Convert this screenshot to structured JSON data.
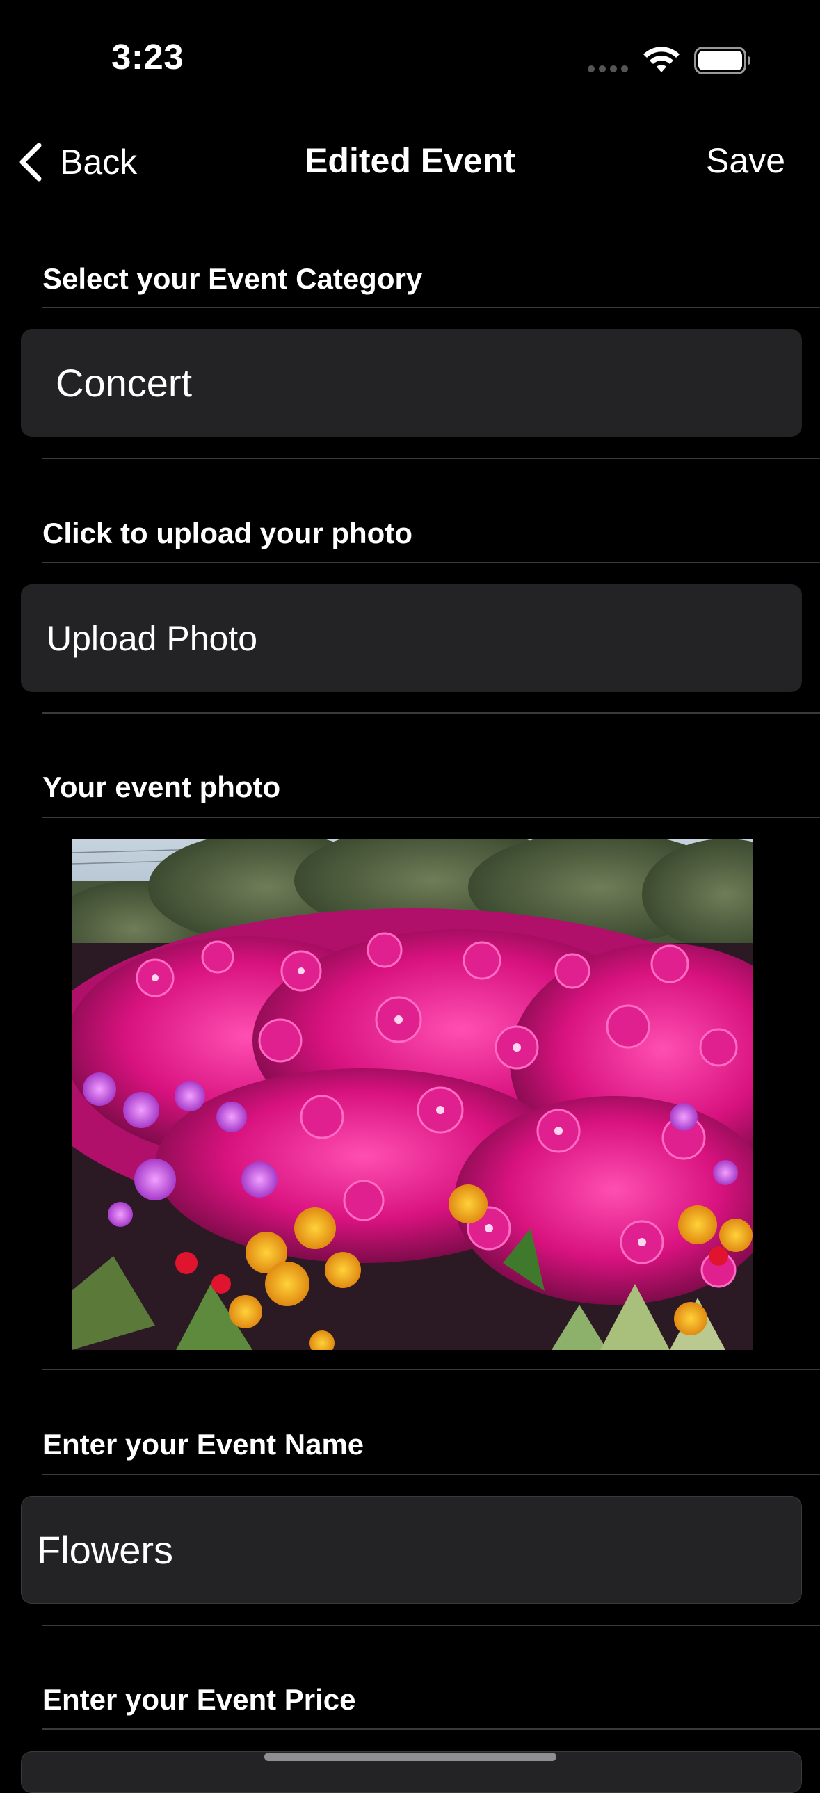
{
  "status_bar": {
    "time": "3:23",
    "icons": [
      "signal-dots-icon",
      "wifi-icon",
      "battery-icon"
    ]
  },
  "nav": {
    "back_label": "Back",
    "title": "Edited Event",
    "save_label": "Save"
  },
  "form": {
    "category": {
      "header": "Select your Event Category",
      "value": "Concert"
    },
    "upload": {
      "header": "Click to upload your photo",
      "button_label": "Upload Photo"
    },
    "photo": {
      "header": "Your event photo"
    },
    "name": {
      "header": "Enter your Event Name",
      "value": "Flowers"
    },
    "price": {
      "header": "Enter your Event Price"
    }
  },
  "colors": {
    "background": "#000000",
    "field_background": "#232325",
    "divider": "#3a3a3c",
    "text": "#ffffff"
  }
}
